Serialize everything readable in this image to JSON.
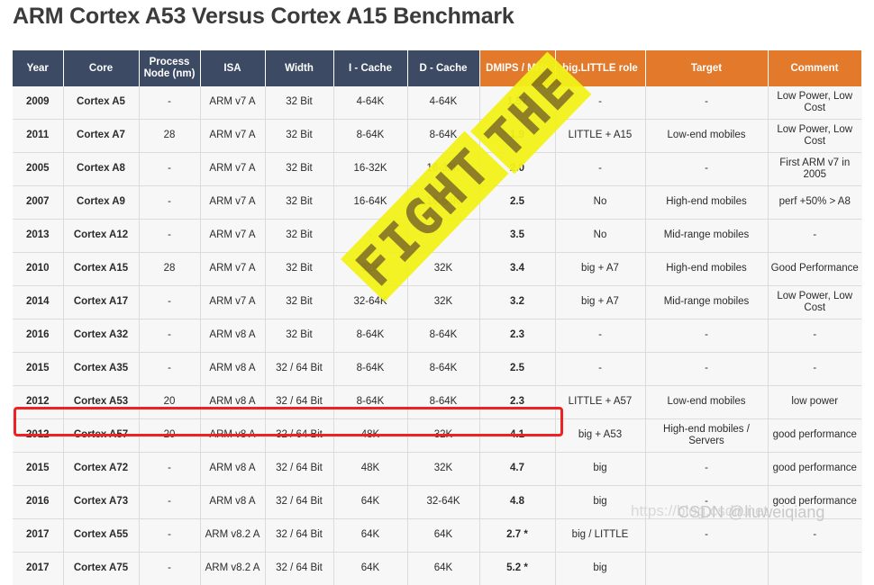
{
  "page": {
    "title": "ARM Cortex A53 Versus Cortex A15 Benchmark",
    "background_color": "#ffffff",
    "title_color": "#3b3b3b"
  },
  "table": {
    "header_navy_color": "#3c4a63",
    "header_orange_color": "#e2792b",
    "row_background": "#f7f7f7",
    "columns": [
      {
        "key": "year",
        "label": "Year",
        "group": "navy"
      },
      {
        "key": "core",
        "label": "Core",
        "group": "navy"
      },
      {
        "key": "proc",
        "label": "Process Node (nm)",
        "group": "navy"
      },
      {
        "key": "isa",
        "label": "ISA",
        "group": "navy"
      },
      {
        "key": "width",
        "label": "Width",
        "group": "navy"
      },
      {
        "key": "icache",
        "label": "I - Cache",
        "group": "navy"
      },
      {
        "key": "dcache",
        "label": "D - Cache",
        "group": "navy"
      },
      {
        "key": "dmips",
        "label": "DMIPS / MHz",
        "group": "orange"
      },
      {
        "key": "role",
        "label": "big.LITTLE role",
        "group": "orange"
      },
      {
        "key": "target",
        "label": "Target",
        "group": "orange"
      },
      {
        "key": "comment",
        "label": "Comment",
        "group": "orange"
      }
    ],
    "rows": [
      {
        "year": "2009",
        "core": "Cortex A5",
        "proc": "-",
        "isa": "ARM v7 A",
        "width": "32 Bit",
        "icache": "4-64K",
        "dcache": "4-64K",
        "dmips": "1.57",
        "role": "-",
        "target": "-",
        "comment": "Low Power, Low Cost"
      },
      {
        "year": "2011",
        "core": "Cortex A7",
        "proc": "28",
        "isa": "ARM v7 A",
        "width": "32 Bit",
        "icache": "8-64K",
        "dcache": "8-64K",
        "dmips": "1.9",
        "role": "LITTLE + A15",
        "target": "Low-end mobiles",
        "comment": "Low Power, Low Cost"
      },
      {
        "year": "2005",
        "core": "Cortex A8",
        "proc": "-",
        "isa": "ARM v7 A",
        "width": "32 Bit",
        "icache": "16-32K",
        "dcache": "16-32K",
        "dmips": "2.0",
        "role": "-",
        "target": "-",
        "comment": "First ARM v7 in 2005"
      },
      {
        "year": "2007",
        "core": "Cortex A9",
        "proc": "-",
        "isa": "ARM v7 A",
        "width": "32 Bit",
        "icache": "16-64K",
        "dcache": "16-64K",
        "dmips": "2.5",
        "role": "No",
        "target": "High-end mobiles",
        "comment": "perf +50% > A8"
      },
      {
        "year": "2013",
        "core": "Cortex A12",
        "proc": "-",
        "isa": "ARM v7 A",
        "width": "32 Bit",
        "icache": "-",
        "dcache": "",
        "dmips": "3.5",
        "role": "No",
        "target": "Mid-range mobiles",
        "comment": "-"
      },
      {
        "year": "2010",
        "core": "Cortex A15",
        "proc": "28",
        "isa": "ARM v7 A",
        "width": "32 Bit",
        "icache": "32K",
        "dcache": "32K",
        "dmips": "3.4",
        "role": "big + A7",
        "target": "High-end mobiles",
        "comment": "Good Performance"
      },
      {
        "year": "2014",
        "core": "Cortex A17",
        "proc": "-",
        "isa": "ARM v7 A",
        "width": "32 Bit",
        "icache": "32-64K",
        "dcache": "32K",
        "dmips": "3.2",
        "role": "big + A7",
        "target": "Mid-range mobiles",
        "comment": "Low Power, Low Cost"
      },
      {
        "year": "2016",
        "core": "Cortex A32",
        "proc": "-",
        "isa": "ARM v8 A",
        "width": "32 Bit",
        "icache": "8-64K",
        "dcache": "8-64K",
        "dmips": "2.3",
        "role": "-",
        "target": "-",
        "comment": "-"
      },
      {
        "year": "2015",
        "core": "Cortex A35",
        "proc": "-",
        "isa": "ARM v8 A",
        "width": "32 / 64 Bit",
        "icache": "8-64K",
        "dcache": "8-64K",
        "dmips": "2.5",
        "role": "-",
        "target": "-",
        "comment": "-"
      },
      {
        "year": "2012",
        "core": "Cortex A53",
        "proc": "20",
        "isa": "ARM v8 A",
        "width": "32 / 64 Bit",
        "icache": "8-64K",
        "dcache": "8-64K",
        "dmips": "2.3",
        "role": "LITTLE + A57",
        "target": "Low-end mobiles",
        "comment": "low power"
      },
      {
        "year": "2012",
        "core": "Cortex A57",
        "proc": "20",
        "isa": "ARM v8 A",
        "width": "32 / 64 Bit",
        "icache": "48K",
        "dcache": "32K",
        "dmips": "4.1",
        "role": "big + A53",
        "target": "High-end mobiles / Servers",
        "comment": "good performance"
      },
      {
        "year": "2015",
        "core": "Cortex A72",
        "proc": "-",
        "isa": "ARM v8 A",
        "width": "32 / 64 Bit",
        "icache": "48K",
        "dcache": "32K",
        "dmips": "4.7",
        "role": "big",
        "target": "-",
        "comment": "good performance",
        "highlighted": true
      },
      {
        "year": "2016",
        "core": "Cortex A73",
        "proc": "-",
        "isa": "ARM v8 A",
        "width": "32 / 64 Bit",
        "icache": "64K",
        "dcache": "32-64K",
        "dmips": "4.8",
        "role": "big",
        "target": "-",
        "comment": "good performance"
      },
      {
        "year": "2017",
        "core": "Cortex A55",
        "proc": "-",
        "isa": "ARM v8.2 A",
        "width": "32 / 64 Bit",
        "icache": "64K",
        "dcache": "64K",
        "dmips": "2.7 *",
        "role": "big / LITTLE",
        "target": "-",
        "comment": "-"
      },
      {
        "year": "2017",
        "core": "Cortex A75",
        "proc": "-",
        "isa": "ARM v8.2 A",
        "width": "32 / 64 Bit",
        "icache": "64K",
        "dcache": "64K",
        "dmips": "5.2 *",
        "role": "big",
        "target": "",
        "comment": ""
      }
    ]
  },
  "highlight": {
    "color": "#ee2222",
    "target_core": "Cortex A72"
  },
  "watermarks": {
    "diagonal_line1": "THE",
    "diagonal_line2": "FIGHT",
    "diagonal_color": "#f2f21a",
    "diagonal_text_color": "#8a7a1c",
    "csdn_url": "https://blog.csdn.net",
    "csdn_tag": "CSDN @liuweiqiang"
  }
}
